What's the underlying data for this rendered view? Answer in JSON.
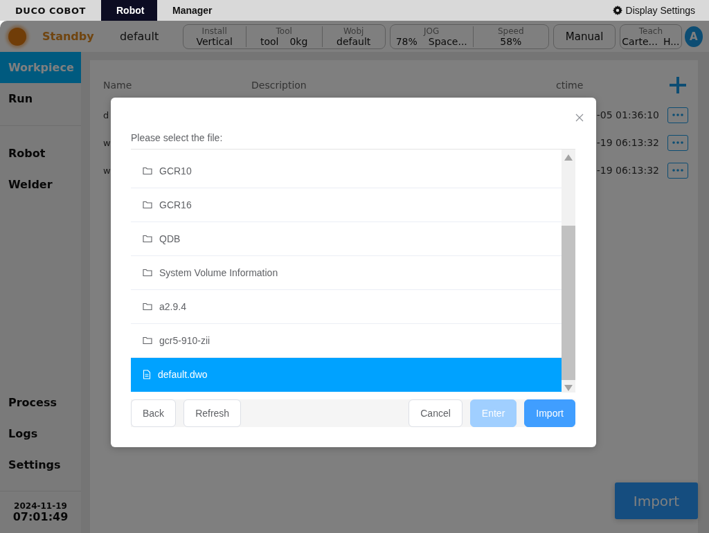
{
  "top_bar": {
    "logo": "DUCO COBOT",
    "tabs": [
      {
        "label": "Robot",
        "selected": true
      },
      {
        "label": "Manager",
        "selected": false
      }
    ],
    "display_settings": "Display Settings"
  },
  "status_bar": {
    "state": "Standby",
    "program": "default",
    "groups": [
      {
        "kind": "fields",
        "fields": [
          {
            "label": "Install",
            "values": [
              "Vertical"
            ]
          },
          {
            "label": "Tool",
            "values": [
              "tool",
              "0kg"
            ]
          },
          {
            "label": "Wobj",
            "values": [
              "default"
            ]
          }
        ]
      },
      {
        "kind": "fields",
        "fields": [
          {
            "label": "JOG",
            "values": [
              "78%",
              "Space..."
            ]
          },
          {
            "label": "Speed",
            "values": [
              "58%"
            ]
          }
        ]
      },
      {
        "kind": "button",
        "label": "Manual"
      },
      {
        "kind": "fields",
        "fields": [
          {
            "label": "Teach",
            "values": [
              "Carte...",
              "H..."
            ]
          }
        ]
      }
    ],
    "user": "A"
  },
  "sidebar": {
    "sections": [
      {
        "items": [
          {
            "label": "Workpiece",
            "selected": true
          },
          {
            "label": "Run",
            "selected": false
          }
        ]
      },
      {
        "items": [
          {
            "label": "Robot",
            "selected": false
          },
          {
            "label": "Welder",
            "selected": false
          }
        ]
      },
      {
        "items": [
          {
            "label": "Process",
            "selected": false
          },
          {
            "label": "Logs",
            "selected": false
          },
          {
            "label": "Settings",
            "selected": false
          }
        ]
      }
    ],
    "date": "2024-11-19",
    "time": "07:01:49"
  },
  "table": {
    "columns": [
      "Name",
      "Description",
      "ctime"
    ],
    "rows": [
      {
        "name": "d",
        "ctime": "-05 01:36:10"
      },
      {
        "name": "w",
        "ctime": "-19 06:13:32"
      },
      {
        "name": "w",
        "ctime": "-19 06:13:32"
      }
    ],
    "import_button": "Import"
  },
  "dialog": {
    "prompt": "Please select the file:",
    "files": [
      {
        "kind": "folder",
        "name": "GCR10",
        "selected": false
      },
      {
        "kind": "folder",
        "name": "GCR16",
        "selected": false
      },
      {
        "kind": "folder",
        "name": "QDB",
        "selected": false
      },
      {
        "kind": "folder",
        "name": "System Volume Information",
        "selected": false
      },
      {
        "kind": "folder",
        "name": "a2.9.4",
        "selected": false
      },
      {
        "kind": "folder",
        "name": "gcr5-910-zii",
        "selected": false
      },
      {
        "kind": "file",
        "name": "default.dwo",
        "selected": true
      }
    ],
    "left_buttons": [
      "Back",
      "Refresh"
    ],
    "right_buttons": [
      {
        "label": "Cancel",
        "kind": "plain",
        "disabled": false
      },
      {
        "label": "Enter",
        "kind": "primary",
        "disabled": true
      },
      {
        "label": "Import",
        "kind": "primary",
        "disabled": false
      }
    ]
  }
}
